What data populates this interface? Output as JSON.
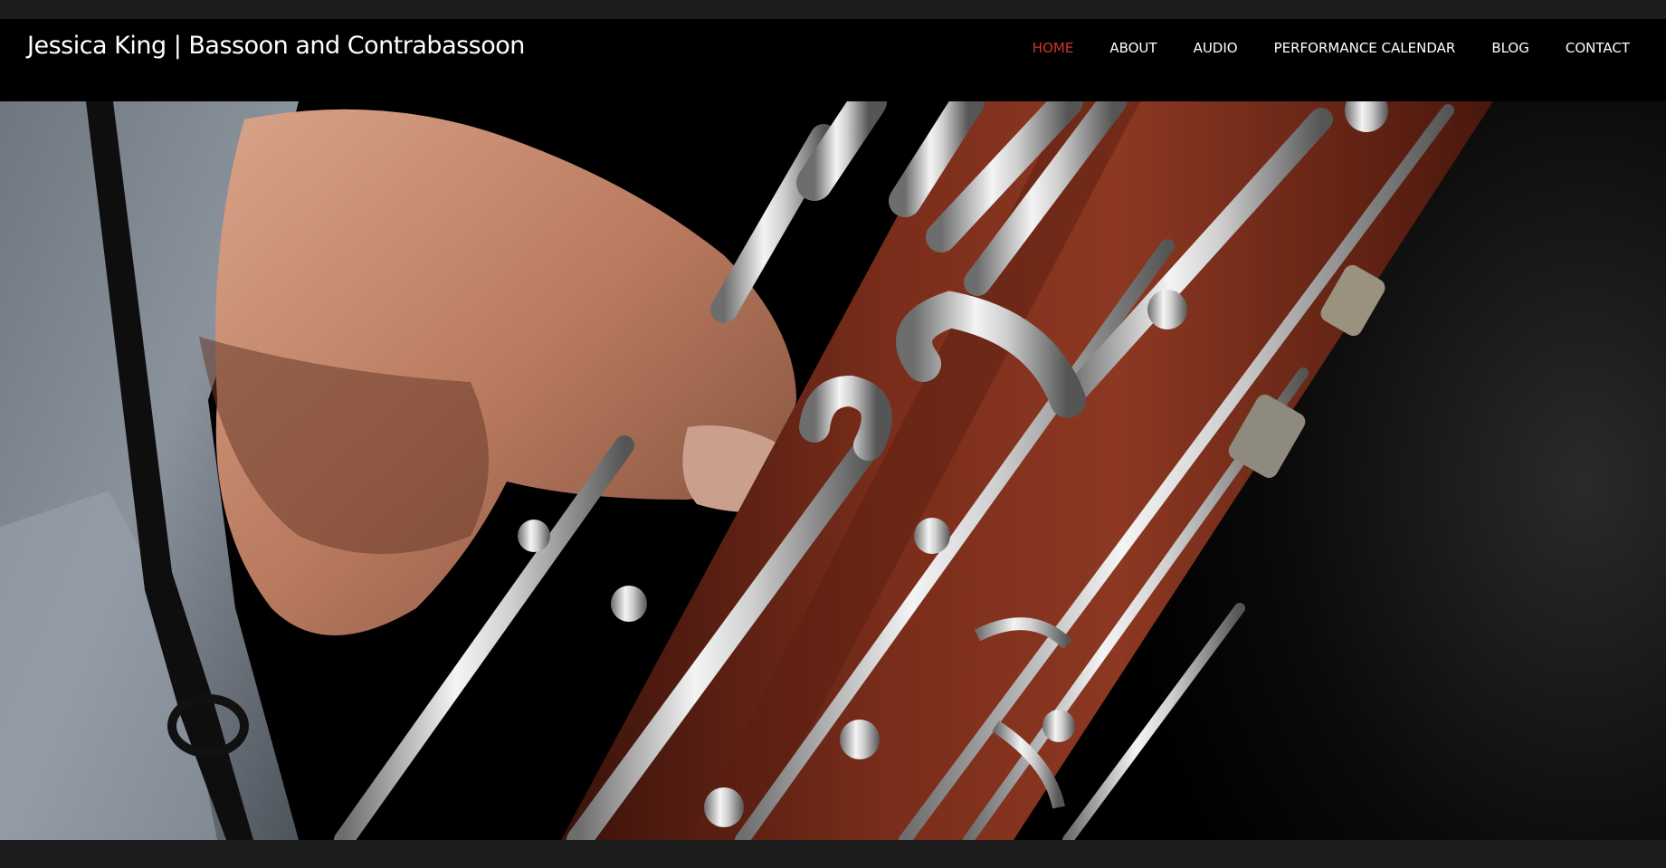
{
  "site": {
    "title": "Jessica King | Bassoon and Contrabassoon"
  },
  "nav": {
    "items": [
      {
        "label": "HOME",
        "active": true
      },
      {
        "label": "ABOUT",
        "active": false
      },
      {
        "label": "AUDIO",
        "active": false
      },
      {
        "label": "PERFORMANCE CALENDAR",
        "active": false
      },
      {
        "label": "BLOG",
        "active": false
      },
      {
        "label": "CONTACT",
        "active": false
      }
    ]
  },
  "colors": {
    "accent": "#d0352a",
    "header_bg": "#000000",
    "text": "#ffffff"
  }
}
